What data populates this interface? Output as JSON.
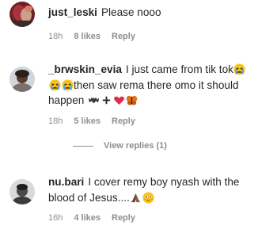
{
  "comments": [
    {
      "username": "just_leski",
      "text": "Please nooo",
      "time": "18h",
      "likes": "8 likes",
      "reply": "Reply"
    },
    {
      "username": "_brwskin_evia",
      "text_1": "I just came from tik tok",
      "text_2": "then saw rema there omo it should happen",
      "emoji_1": [
        "crying-face",
        "crying-face",
        "crying-face"
      ],
      "emoji_2": [
        "bat",
        "plus",
        "heart",
        "butterfly"
      ],
      "time": "18h",
      "likes": "5 likes",
      "reply": "Reply",
      "view_replies": "View replies (1)"
    },
    {
      "username": "nu.bari",
      "text": "I cover remy boy nyash with the blood of Jesus....",
      "emoji": [
        "folded-hands",
        "flushed-face"
      ],
      "time": "16h",
      "likes": "4 likes",
      "reply": "Reply"
    }
  ],
  "colors": {
    "text": "#262626",
    "secondary": "#8e8e8e",
    "background": "#ffffff"
  }
}
